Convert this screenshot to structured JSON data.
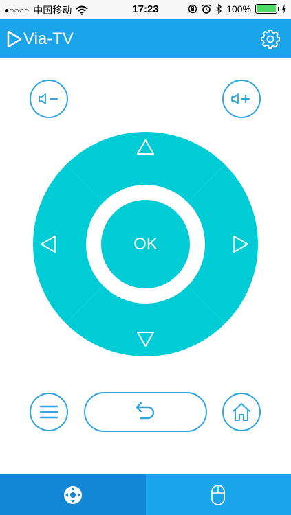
{
  "status_bar": {
    "signal": "●○○○○",
    "carrier": "中国移动",
    "time": "17:23",
    "battery_percent": "100%",
    "battery_level": 1.0
  },
  "header": {
    "app_title": "Via-TV"
  },
  "remote": {
    "ok_label": "OK"
  },
  "colors": {
    "header_blue": "#1aa4ea",
    "tab_active": "#1287d6",
    "dpad_teal": "#00ccd5",
    "button_outline": "#2fa6e4"
  },
  "icons": {
    "settings": "gear-icon",
    "volume_down": "volume-down-icon",
    "volume_up": "volume-up-icon",
    "menu": "menu-icon",
    "back": "back-icon",
    "home": "home-icon",
    "remote_tab": "dpad-icon",
    "mouse_tab": "mouse-icon"
  }
}
